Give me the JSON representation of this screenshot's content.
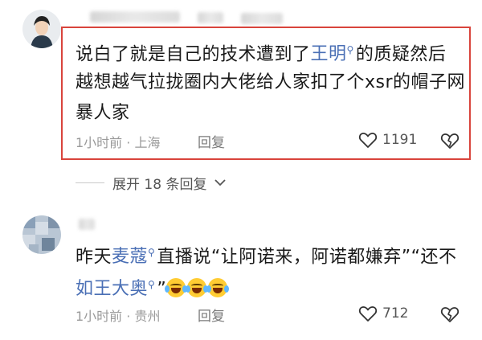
{
  "comments": [
    {
      "line1_a": "说白了就是自己的技术遭到了",
      "line1_mention": "王明",
      "line1_b": "的质疑然后",
      "line2": "越想越气拉拢圈内大佬给人家扣了个xsr的帽子网",
      "line3": "暴人家",
      "time": "1小时前",
      "dot": "·",
      "location": "上海",
      "reply_label": "回复",
      "likes": "1191"
    },
    {
      "line1_a": "昨天",
      "line1_mention": "麦蔻",
      "line1_b": "直播说“让阿诺来，阿诺都嫌弃”“还不",
      "line2_mention": "如王大奥",
      "line2_b": "”",
      "time": "1小时前",
      "dot": "·",
      "location": "贵州",
      "reply_label": "回复",
      "likes": "712"
    }
  ],
  "expand_replies": "展开 18 条回复",
  "icons": {
    "mention": "search-icon",
    "like": "heart-outline-icon",
    "dislike": "broken-heart-icon",
    "expand": "chevron-down-icon",
    "emoji": "laughing-crying-emoji"
  },
  "colors": {
    "mention": "#4a6fb5",
    "highlight_border": "#d9443c",
    "meta": "#9a9a9a"
  }
}
